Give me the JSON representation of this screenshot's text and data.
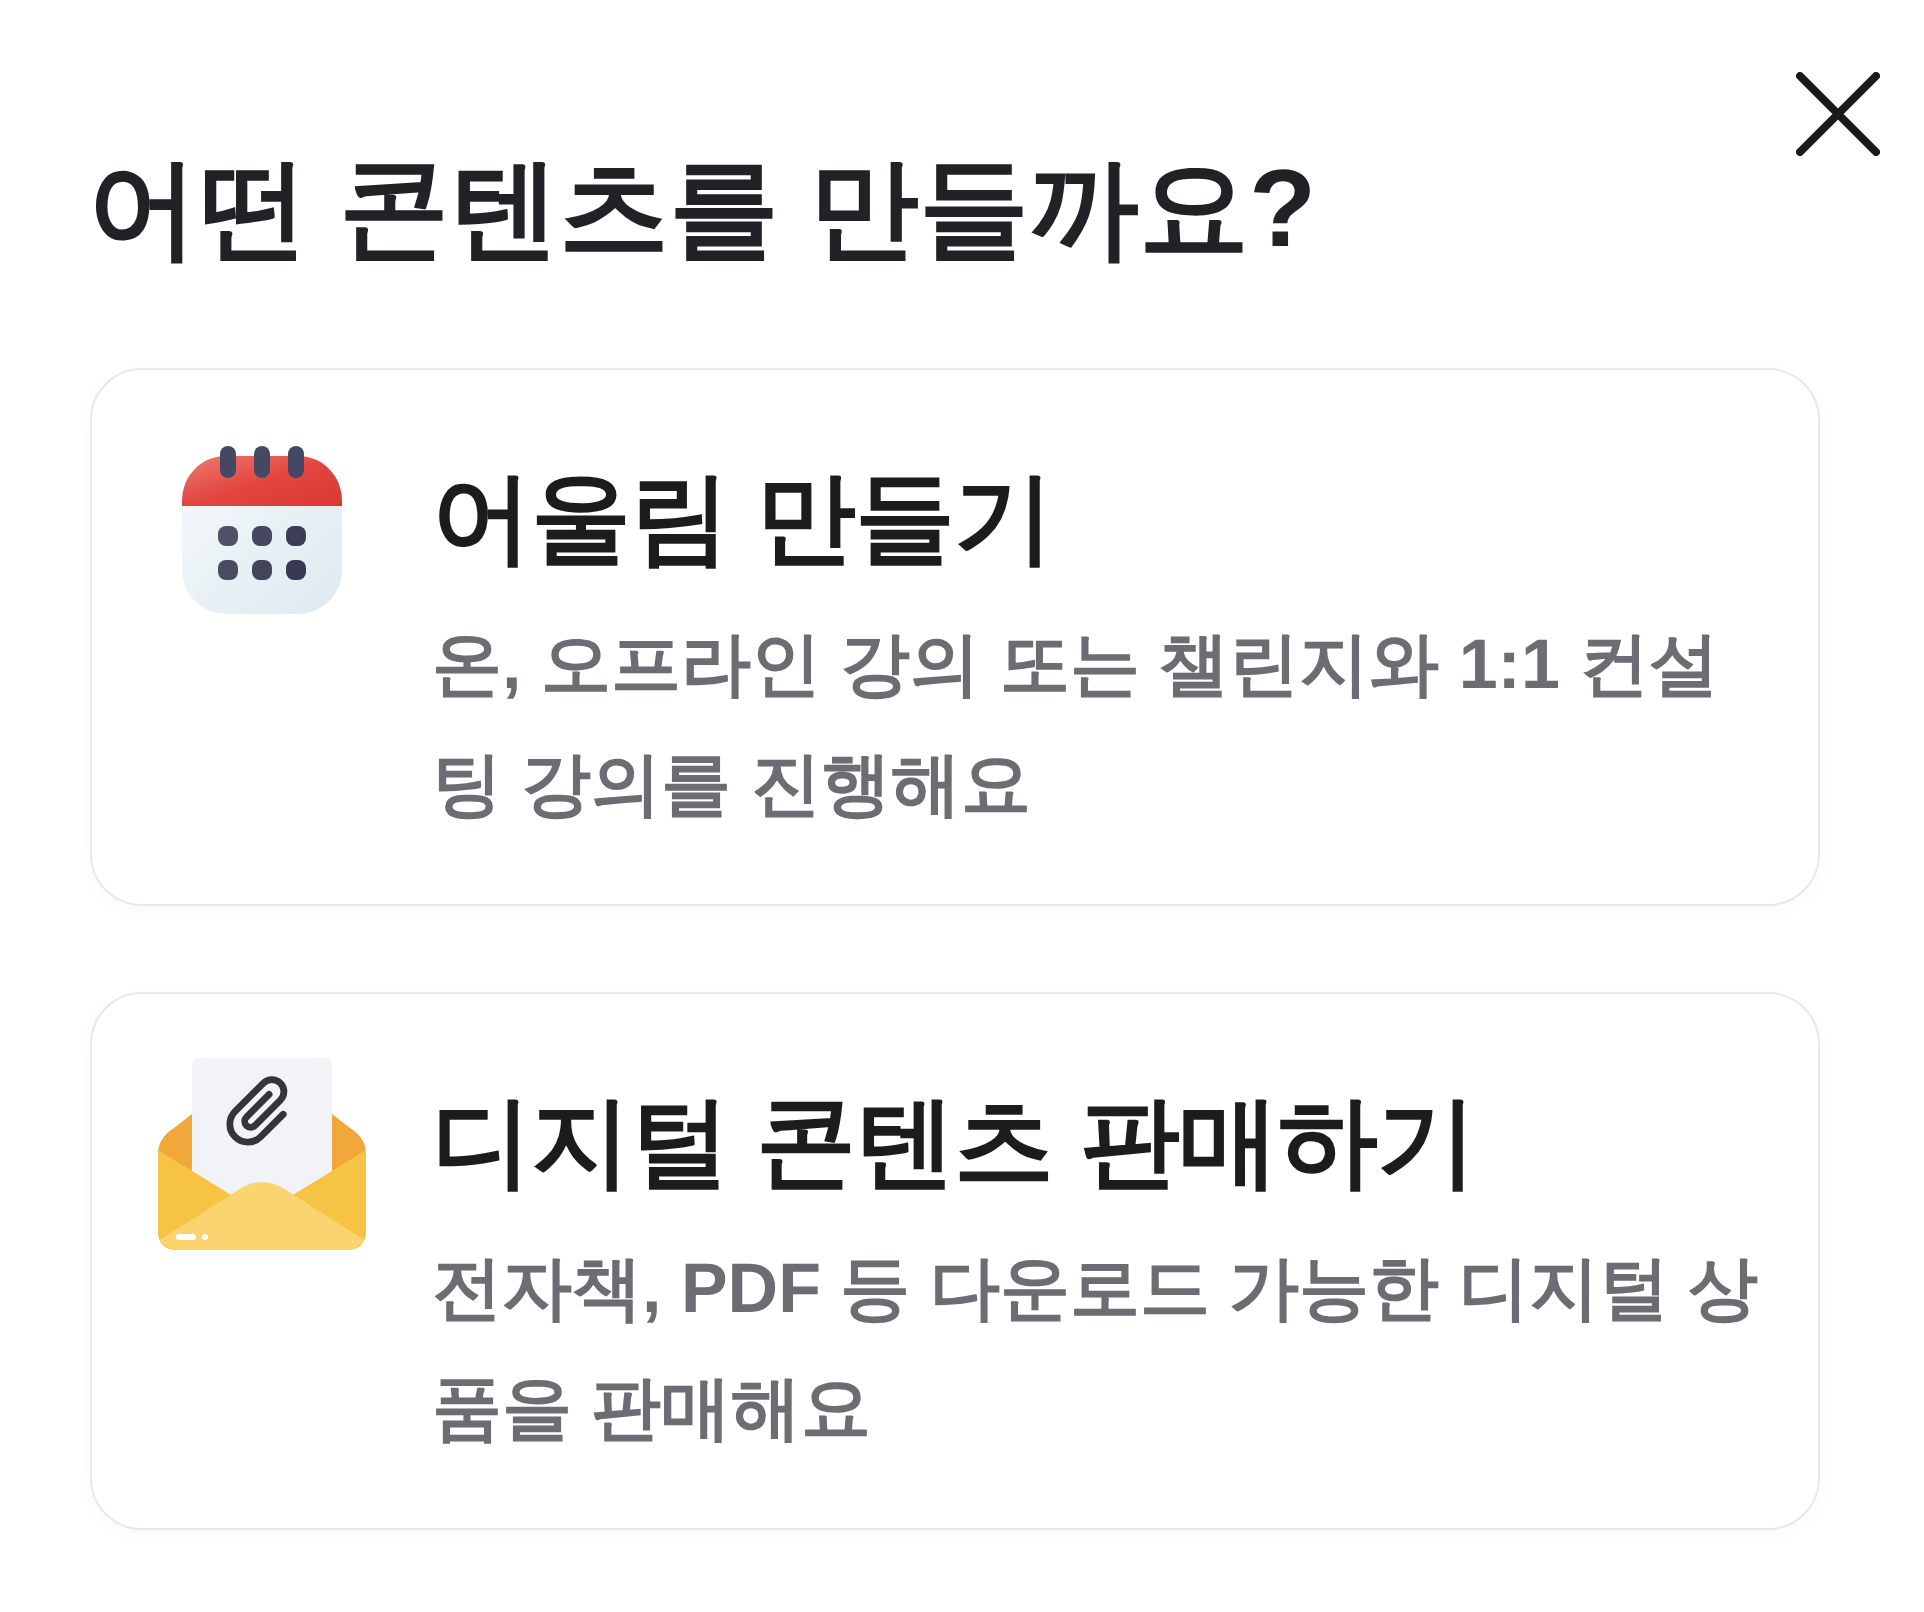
{
  "title": "어떤 콘텐츠를 만들까요?",
  "options": [
    {
      "kind": "calendar",
      "title": "어울림 만들기",
      "description": "온, 오프라인 강의 또는 챌린지와 1:1 컨설팅 강의를 진행해요"
    },
    {
      "kind": "envelope",
      "title": "디지털 콘텐츠 판매하기",
      "description": "전자책, PDF 등 다운로드 가능한 디지털 상품을 판매해요"
    }
  ]
}
